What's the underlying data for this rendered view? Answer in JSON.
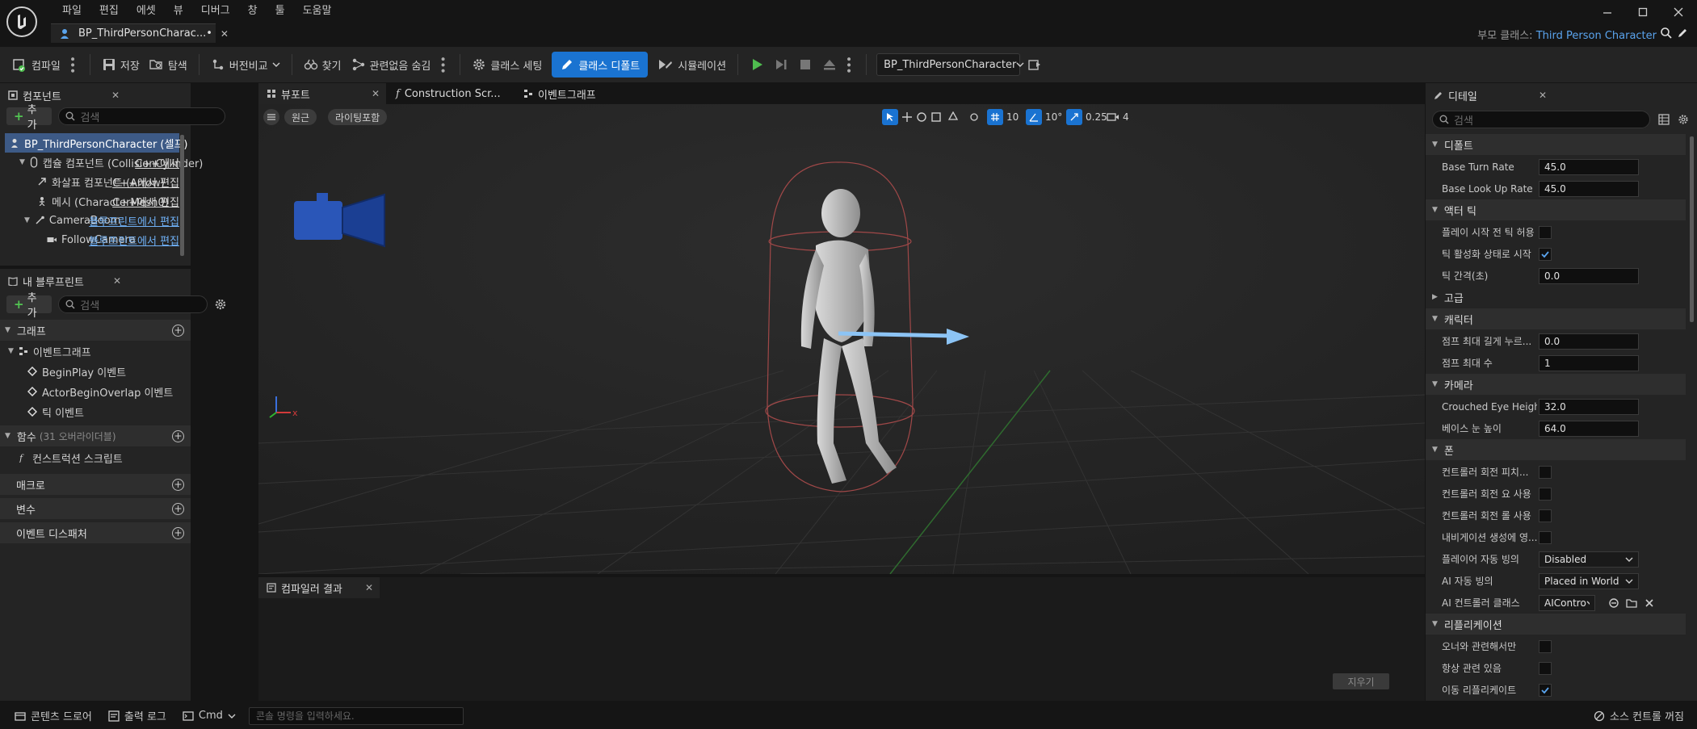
{
  "menu": [
    "파일",
    "편집",
    "에셋",
    "뷰",
    "디버그",
    "창",
    "툴",
    "도움말"
  ],
  "doc_tab": {
    "label": "BP_ThirdPersonCharac...•"
  },
  "parent_class": {
    "label": "부모 클래스:",
    "value": "Third Person Character"
  },
  "toolbar": {
    "compile": "컴파일",
    "save": "저장",
    "browse": "탐색",
    "diff": "버전비교",
    "find": "찾기",
    "hide_unrelated": "관련없음 숨김",
    "class_settings": "클래스 세팅",
    "class_defaults": "클래스 디폴트",
    "simulation": "시뮬레이션",
    "bp_selector": "BP_ThirdPersonCharacter"
  },
  "components": {
    "tab": "컴포넌트",
    "add": "추가",
    "search_placeholder": "검색",
    "items": [
      {
        "name": "BP_ThirdPersonCharacter (셀프)",
        "edit": ""
      },
      {
        "name": "캡슐 컴포넌트 (CollisionCylinder)",
        "edit": "C++에서"
      },
      {
        "name": "화살표 컴포넌트 (Arrow)",
        "edit": "C++에서 편집"
      },
      {
        "name": "메시 (CharacterMesh0)",
        "edit": "C++에서 편집"
      },
      {
        "name": "CameraBoom",
        "edit": "블루프린트에서 편집"
      },
      {
        "name": "FollowCamera",
        "edit": "블루프린트에서 편집"
      }
    ]
  },
  "my_blueprint": {
    "tab": "내 블루프린트",
    "add": "추가",
    "search_placeholder": "검색",
    "graph_section": "그래프",
    "event_graph": "이벤트그래프",
    "events": [
      "BeginPlay 이벤트",
      "ActorBeginOverlap 이벤트",
      "틱 이벤트"
    ],
    "functions_section": "함수",
    "functions_overridable": "(31 오버라이더블)",
    "construction_script": "컨스트럭션 스크립트",
    "macros_section": "매크로",
    "variables_section": "변수",
    "dispatchers_section": "이벤트 디스패처"
  },
  "editor_tabs": [
    "뷰포트",
    "Construction Scr...",
    "이벤트그래프"
  ],
  "viewport": {
    "perspective": "원근",
    "lighting": "라이팅포함",
    "grid_snap": "10",
    "rot_snap": "10°",
    "scale_snap": "0.25",
    "camera_speed": "4"
  },
  "compiler": {
    "tab": "컴파일러 결과",
    "clear": "지우기"
  },
  "details": {
    "tab": "디테일",
    "search_placeholder": "검색",
    "sections": {
      "default": "디폴트",
      "actor_tick": "액터 틱",
      "advanced": "고급",
      "character": "캐릭터",
      "camera": "카메라",
      "pawn": "폰",
      "replication": "리플리케이션"
    },
    "rows": {
      "base_turn_rate": {
        "label": "Base Turn Rate",
        "value": "45.0"
      },
      "base_lookup_rate": {
        "label": "Base Look Up Rate",
        "value": "45.0"
      },
      "tick_before_begin": {
        "label": "플레이 시작 전 틱 허용",
        "checked": false
      },
      "start_tick_enabled": {
        "label": "틱 활성화 상태로 시작",
        "checked": true
      },
      "tick_interval": {
        "label": "틱 간격(초)",
        "value": "0.0"
      },
      "jump_max_hold": {
        "label": "점프 최대 길게 누르...",
        "value": "0.0"
      },
      "jump_max_count": {
        "label": "점프 최대 수",
        "value": "1"
      },
      "crouched_eye": {
        "label": "Crouched Eye Height",
        "value": "32.0"
      },
      "base_eye": {
        "label": "베이스 눈 높이",
        "value": "64.0"
      },
      "ctrl_pitch": {
        "label": "컨트롤러 회전 피치...",
        "checked": false
      },
      "ctrl_yaw": {
        "label": "컨트롤러 회전 요 사용",
        "checked": false
      },
      "ctrl_roll": {
        "label": "컨트롤러 회전 롤 사용",
        "checked": false
      },
      "nav_gen": {
        "label": "내비게이션 생성에 영...",
        "checked": false
      },
      "auto_possess_player": {
        "label": "플레이어 자동 빙의",
        "value": "Disabled"
      },
      "auto_possess_ai": {
        "label": "AI 자동 빙의",
        "value": "Placed in World"
      },
      "ai_controller": {
        "label": "AI 컨트롤러 클래스",
        "value": "AIContro"
      },
      "only_owner": {
        "label": "오너와 관련해서만",
        "checked": false
      },
      "always_relevant": {
        "label": "항상 관련 있음",
        "checked": false
      },
      "replicate_movement": {
        "label": "이동 리플리케이트",
        "checked": true
      }
    }
  },
  "statusbar": {
    "content_drawer": "콘텐츠 드로어",
    "output_log": "출력 로그",
    "cmd": "Cmd",
    "console_placeholder": "콘솔 명령을 입력하세요.",
    "source_control": "소스 컨트롤 꺼짐"
  },
  "colors": {
    "accent": "#1a73d1",
    "link": "#5aa4ee",
    "play": "#4fbd4f",
    "panel": "#242424",
    "bg": "#151515"
  }
}
